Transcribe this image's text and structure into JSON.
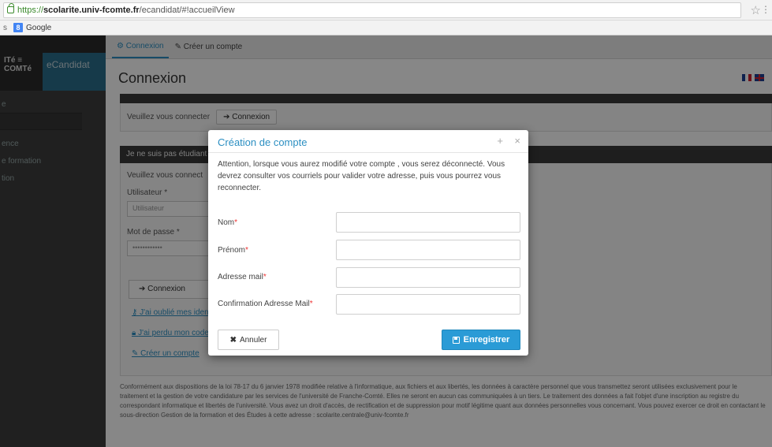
{
  "browser": {
    "url_scheme": "https://",
    "url_host": "scolarite.univ-fcomte.fr",
    "url_path": "/ecandidat/#!accueilView",
    "bookmark_apps": "s",
    "bookmark_google_letter": "8",
    "bookmark_google": "Google"
  },
  "sidebar": {
    "logo_univ_line1": "ITé ≡",
    "logo_univ_line2": "COMTé",
    "app_name": "eCandidat",
    "items": [
      "e",
      "",
      "ence",
      "e formation",
      "tion"
    ]
  },
  "topnav": {
    "tab_connexion": "Connexion",
    "tab_create": "Créer un compte"
  },
  "page": {
    "title": "Connexion",
    "panel1_prompt": "Veuillez vous connecter",
    "panel1_button": "Connexion",
    "panel2_header": "Je ne suis pas étudiant",
    "panel2_prompt": "Veuillez vous connect",
    "user_label": "Utilisateur *",
    "user_placeholder": "Utilisateur",
    "password_label": "Mot de passe *",
    "password_value": "••••••••••••",
    "connect_button": "Connexion",
    "link_forgot": "J'ai oublié mes ident",
    "link_unlock": "J'ai perdu mon code",
    "link_create": "Créer un compte",
    "legal_text": "Conformément aux dispositions de la loi 78-17 du 6 janvier 1978 modifiée relative à l'informatique, aux fichiers et aux libertés, les données à caractère personnel que vous transmettez seront utilisées exclusivement pour le traitement et la gestion de votre candidature par les services de l'université de Franche-Comté. Elles ne seront en aucun cas communiquées à un tiers. Le traitement des données a fait l'objet d'une inscription au registre du correspondant informatique et libertés de l'université. Vous avez un droit d'accès, de rectification et de suppression pour motif légitime quant aux données personnelles vous concernant. Vous pouvez exercer ce droit en contactant le sous-direction Gestion de la formation et des Études à cette adresse : scolarite.centrale@univ-fcomte.fr"
  },
  "modal": {
    "title": "Création de compte",
    "message": "Attention, lorsque vous aurez modifié votre compte , vous serez déconnecté. Vous devrez consulter vos courriels pour valider votre adresse, puis vous pourrez vous reconnecter.",
    "fields": [
      {
        "label": "Nom",
        "value": ""
      },
      {
        "label": "Prénom",
        "value": ""
      },
      {
        "label": "Adresse mail",
        "value": ""
      },
      {
        "label": "Confirmation Adresse Mail",
        "value": ""
      }
    ],
    "required_mark": "*",
    "cancel_label": "Annuler",
    "save_label": "Enregistrer"
  },
  "colors": {
    "accent": "#2a9bd6",
    "title_blue": "#2c8fc2",
    "required": "#ee3333"
  }
}
